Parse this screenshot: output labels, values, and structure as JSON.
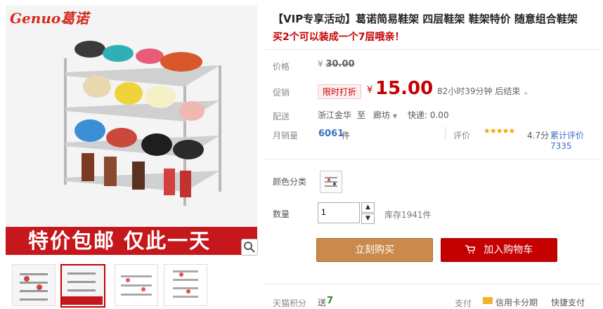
{
  "brand": "Genuo葛诺",
  "banner_text": "特价包邮  仅此一天",
  "title": "【VIP专享活动】葛诺简易鞋架 四层鞋架 鞋架特价 随意组合鞋架",
  "subtitle": "买2个可以装成一个7层哦亲！",
  "price": {
    "label": "价格",
    "currency": "¥",
    "original": "30.00"
  },
  "promo": {
    "label": "促销",
    "tag": "限时打折",
    "currency": "¥",
    "price": "15.00",
    "countdown": "82小时39分钟 后结束"
  },
  "shipping": {
    "label": "配送",
    "from": "浙江金华",
    "to_word": "至",
    "to": "廊坊",
    "fee": "快递: 0.00"
  },
  "sales": {
    "label": "月销量",
    "count": "6061",
    "unit": "件",
    "rating_label": "评价",
    "rating": "4.7分",
    "reviews": "累计评价7335"
  },
  "color": {
    "label": "颜色分类"
  },
  "quantity": {
    "label": "数量",
    "value": "1",
    "stock": "库存1941件"
  },
  "buttons": {
    "buy_now": "立刻购买",
    "add_cart": "加入购物车"
  },
  "footer": {
    "points_label": "天猫积分",
    "points_prefix": "送",
    "points": "7",
    "pay_label": "支付",
    "credit": "信用卡分期",
    "quick_pay": "快捷支付"
  },
  "colors": {
    "accent": "#c40000",
    "buy": "#c98a4b"
  },
  "icons": [
    "zoom-icon",
    "cart-icon",
    "credit-card-icon",
    "stepper-up-icon",
    "stepper-down-icon"
  ]
}
